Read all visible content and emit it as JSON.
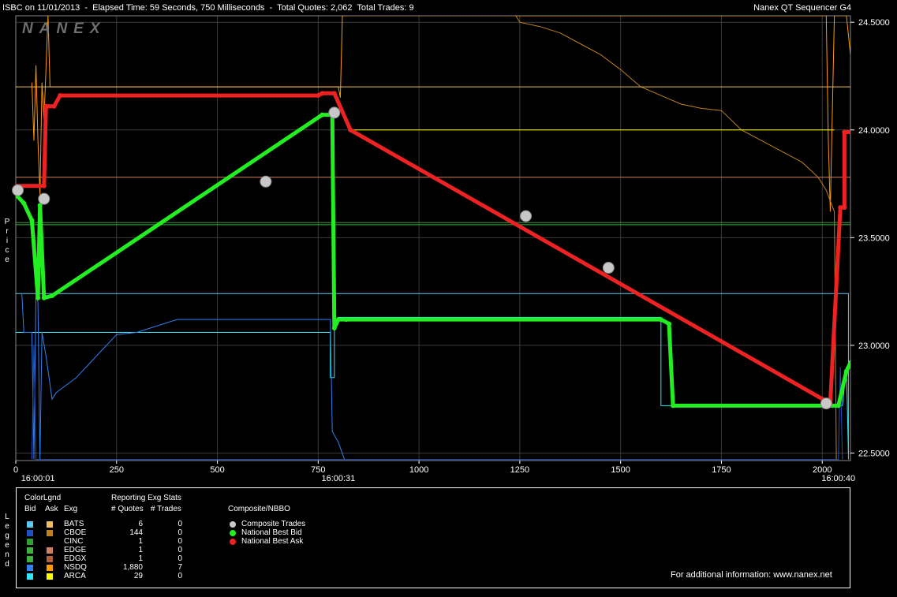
{
  "header": {
    "info": "ISBC on 11/01/2013  -  Elapsed Time: 59 Seconds, 750 Milliseconds  -  Total Quotes: 2,062  Total Trades: 9",
    "app": "Nanex QT Sequencer G4",
    "brand": "NANEX"
  },
  "side_labels": {
    "price": "Price",
    "legend": "Legend"
  },
  "chart_data": {
    "type": "line",
    "title": "",
    "xlabel": "",
    "ylabel": "Price",
    "xlim": [
      0,
      2070
    ],
    "ylim": [
      22.465,
      24.53
    ],
    "x_ticks": [
      0,
      250,
      500,
      750,
      1000,
      1250,
      1500,
      1750,
      2000
    ],
    "y_ticks": [
      22.5,
      23.0,
      23.5,
      24.0,
      24.5
    ],
    "y_tick_labels": [
      "22.5000",
      "23.0000",
      "23.5000",
      "24.0000",
      "24.5000"
    ],
    "time_labels": [
      {
        "x": 55,
        "label": "16:00:01"
      },
      {
        "x": 800,
        "label": "16:00:31"
      },
      {
        "x": 2040,
        "label": "16:00:40"
      }
    ],
    "grid": true,
    "series": [
      {
        "name": "National Best Bid",
        "color": "#22ee22",
        "kind": "nbbo",
        "points": [
          [
            0,
            23.7
          ],
          [
            20,
            23.66
          ],
          [
            40,
            23.58
          ],
          [
            55,
            23.22
          ],
          [
            60,
            23.65
          ],
          [
            70,
            23.22
          ],
          [
            90,
            23.23
          ],
          [
            760,
            24.07
          ],
          [
            785,
            24.07
          ],
          [
            790,
            23.08
          ],
          [
            800,
            23.12
          ],
          [
            820,
            23.12
          ],
          [
            1600,
            23.12
          ],
          [
            1620,
            23.1
          ],
          [
            1630,
            22.72
          ],
          [
            2040,
            22.72
          ],
          [
            2060,
            22.88
          ],
          [
            2070,
            22.92
          ]
        ]
      },
      {
        "name": "National Best Ask",
        "color": "#ee2222",
        "kind": "nbbo",
        "points": [
          [
            0,
            23.74
          ],
          [
            70,
            23.74
          ],
          [
            75,
            24.11
          ],
          [
            95,
            24.11
          ],
          [
            110,
            24.16
          ],
          [
            750,
            24.16
          ],
          [
            760,
            24.17
          ],
          [
            790,
            24.17
          ],
          [
            830,
            24.0
          ],
          [
            2020,
            22.73
          ],
          [
            2045,
            23.64
          ],
          [
            2055,
            23.64
          ],
          [
            2055,
            23.99
          ],
          [
            2085,
            23.99
          ],
          [
            2090,
            24.09
          ]
        ]
      },
      {
        "name": "NSDQ Ask",
        "color": "#ff9900",
        "kind": "exg",
        "points": [
          [
            40,
            24.22
          ],
          [
            45,
            23.95
          ],
          [
            50,
            24.3
          ],
          [
            55,
            23.95
          ],
          [
            60,
            23.7
          ],
          [
            65,
            24.22
          ],
          [
            70,
            24.05
          ],
          [
            80,
            24.53
          ],
          [
            85,
            24.2
          ],
          [
            95,
            24.2
          ],
          [
            800,
            24.2
          ],
          [
            805,
            24.15
          ],
          [
            810,
            24.53
          ],
          [
            2010,
            24.53
          ],
          [
            2015,
            23.96
          ],
          [
            2020,
            23.62
          ],
          [
            2030,
            24.53
          ],
          [
            2060,
            24.53
          ],
          [
            2070,
            24.35
          ]
        ]
      },
      {
        "name": "CBOE Ask",
        "color": "#c08020",
        "kind": "exg",
        "points": [
          [
            820,
            24.53
          ],
          [
            1240,
            24.53
          ],
          [
            1250,
            24.5
          ],
          [
            1300,
            24.48
          ],
          [
            1350,
            24.45
          ],
          [
            1400,
            24.4
          ],
          [
            1450,
            24.35
          ],
          [
            1500,
            24.28
          ],
          [
            1550,
            24.2
          ],
          [
            1600,
            24.16
          ],
          [
            1650,
            24.12
          ],
          [
            1700,
            24.1
          ],
          [
            1750,
            24.09
          ],
          [
            1800,
            24.0
          ],
          [
            1850,
            23.95
          ],
          [
            1900,
            23.9
          ],
          [
            1950,
            23.85
          ],
          [
            1990,
            23.78
          ],
          [
            2010,
            23.72
          ],
          [
            2030,
            23.62
          ],
          [
            2035,
            22.47
          ]
        ]
      },
      {
        "name": "ARCA Ask",
        "color": "#ffff00",
        "kind": "exg",
        "points": [
          [
            830,
            24.0
          ],
          [
            2030,
            24.0
          ]
        ]
      },
      {
        "name": "EDGE Ask",
        "color": "#d08060",
        "kind": "exg",
        "points": [
          [
            0,
            23.78
          ],
          [
            2070,
            23.78
          ]
        ]
      },
      {
        "name": "BATS Ask",
        "color": "#f0c060",
        "kind": "exg",
        "points": [
          [
            0,
            24.2
          ],
          [
            2070,
            24.2
          ]
        ]
      },
      {
        "name": "CINC Bid",
        "color": "#30a030",
        "kind": "exg",
        "points": [
          [
            0,
            23.57
          ],
          [
            2070,
            23.57
          ]
        ]
      },
      {
        "name": "EDGX Bid",
        "color": "#40b040",
        "kind": "exg",
        "points": [
          [
            0,
            23.56
          ],
          [
            2070,
            23.56
          ]
        ]
      },
      {
        "name": "BATS Bid",
        "color": "#60c8f0",
        "kind": "exg",
        "points": [
          [
            0,
            23.24
          ],
          [
            2065,
            23.24
          ],
          [
            2065,
            22.47
          ]
        ]
      },
      {
        "name": "ARCA Bid",
        "color": "#30e8f8",
        "kind": "exg",
        "points": [
          [
            0,
            23.06
          ],
          [
            780,
            23.06
          ],
          [
            780,
            22.85
          ],
          [
            790,
            22.85
          ],
          [
            790,
            23.08
          ],
          [
            800,
            23.13
          ],
          [
            1600,
            23.13
          ],
          [
            1600,
            22.72
          ],
          [
            2050,
            22.72
          ],
          [
            2060,
            22.9
          ],
          [
            2065,
            22.5
          ]
        ]
      },
      {
        "name": "NSDQ Bid",
        "color": "#3080f0",
        "kind": "exg",
        "points": [
          [
            15,
            23.24
          ],
          [
            20,
            23.06
          ],
          [
            40,
            23.06
          ],
          [
            45,
            22.47
          ],
          [
            50,
            23.24
          ],
          [
            55,
            23.2
          ],
          [
            60,
            22.47
          ],
          [
            65,
            23.06
          ],
          [
            75,
            22.95
          ],
          [
            90,
            22.75
          ],
          [
            100,
            22.78
          ],
          [
            150,
            22.85
          ],
          [
            200,
            22.95
          ],
          [
            250,
            23.05
          ],
          [
            300,
            23.06
          ],
          [
            400,
            23.12
          ],
          [
            750,
            23.12
          ],
          [
            780,
            23.12
          ],
          [
            785,
            22.6
          ],
          [
            800,
            22.55
          ],
          [
            815,
            22.47
          ]
        ]
      },
      {
        "name": "CBOE Bid",
        "color": "#2050c0",
        "kind": "exg",
        "points": [
          [
            40,
            22.47
          ],
          [
            45,
            23.0
          ],
          [
            50,
            22.47
          ],
          [
            2040,
            22.47
          ],
          [
            2045,
            22.9
          ],
          [
            2050,
            22.47
          ]
        ]
      }
    ],
    "composite_trades": {
      "name": "Composite Trades",
      "color": "#c8c8c8",
      "points": [
        [
          5,
          23.72
        ],
        [
          70,
          23.68
        ],
        [
          620,
          23.76
        ],
        [
          790,
          24.08
        ],
        [
          1265,
          23.6
        ],
        [
          1470,
          23.36
        ],
        [
          2010,
          22.73
        ]
      ]
    },
    "legend": {
      "placement": "bottom",
      "title": "Composite/NBBO"
    }
  },
  "legend_panel": {
    "color_legend": "ColorLgnd",
    "col_bid": "Bid",
    "col_ask": "Ask",
    "col_exg": "Exg",
    "stats_title": "Reporting Exg Stats",
    "col_quotes": "# Quotes",
    "col_trades": "# Trades",
    "rows": [
      {
        "exg": "BATS",
        "quotes": "6",
        "trades": "0",
        "bid_color": "#60c8f0",
        "ask_color": "#f0c060"
      },
      {
        "exg": "CBOE",
        "quotes": "144",
        "trades": "0",
        "bid_color": "#2050c0",
        "ask_color": "#c08020"
      },
      {
        "exg": "CINC",
        "quotes": "1",
        "trades": "0",
        "bid_color": "#30a030",
        "ask_color": "#000000"
      },
      {
        "exg": "EDGE",
        "quotes": "1",
        "trades": "0",
        "bid_color": "#40b040",
        "ask_color": "#d08060"
      },
      {
        "exg": "EDGX",
        "quotes": "1",
        "trades": "0",
        "bid_color": "#40b040",
        "ask_color": "#b06040"
      },
      {
        "exg": "NSDQ",
        "quotes": "1,880",
        "trades": "7",
        "bid_color": "#3080f0",
        "ask_color": "#ff9900"
      },
      {
        "exg": "ARCA",
        "quotes": "29",
        "trades": "0",
        "bid_color": "#30e8f8",
        "ask_color": "#ffff00"
      }
    ],
    "composite_title": "Composite/NBBO",
    "composite_items": [
      {
        "label": "Composite Trades",
        "color": "#c8c8c8"
      },
      {
        "label": "National Best Bid",
        "color": "#22ee22"
      },
      {
        "label": "National Best Ask",
        "color": "#ee2222"
      }
    ],
    "footer": "For additional information: www.nanex.net"
  }
}
